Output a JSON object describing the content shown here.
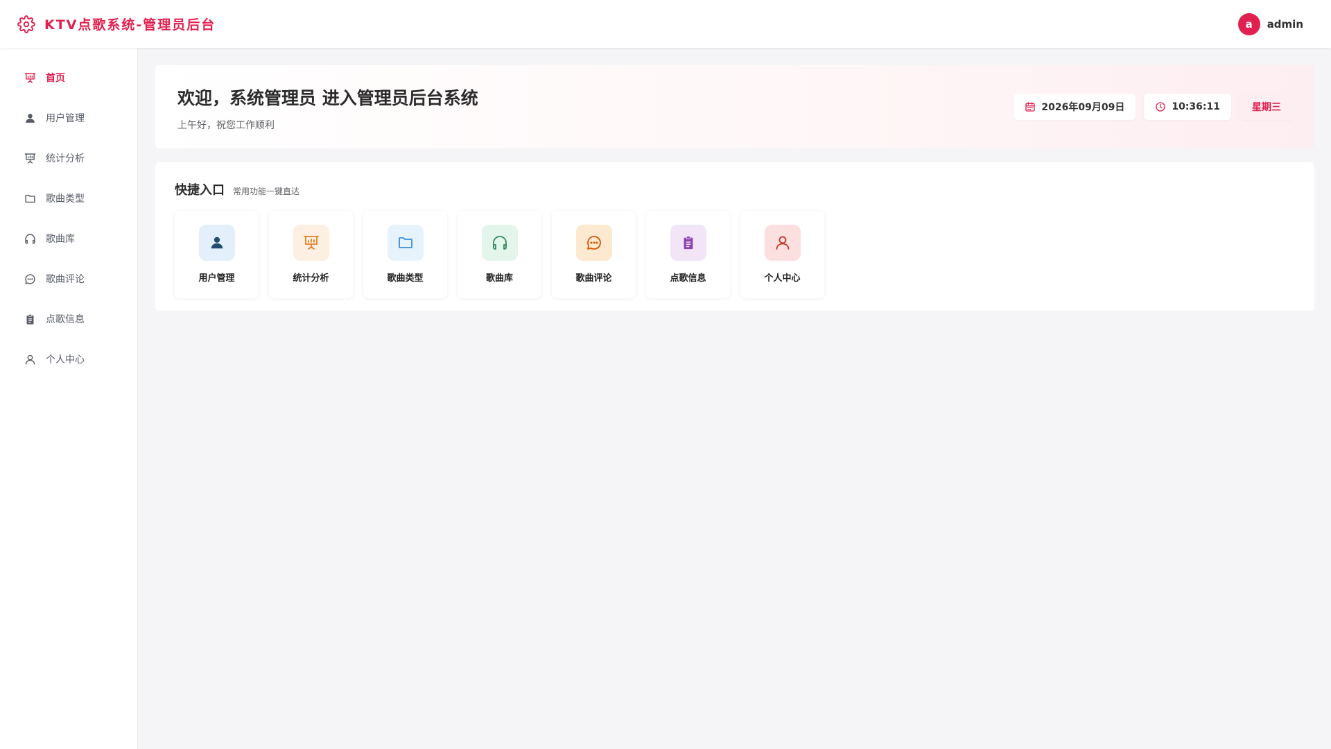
{
  "app": {
    "title": "KTV点歌系统-管理员后台"
  },
  "user": {
    "avatar_letter": "a",
    "name": "admin"
  },
  "colors": {
    "accent": "#e0204f"
  },
  "sidebar": {
    "items": [
      {
        "label": "首页",
        "icon": "presentation-icon",
        "active": true
      },
      {
        "label": "用户管理",
        "icon": "user-icon"
      },
      {
        "label": "统计分析",
        "icon": "presentation-icon"
      },
      {
        "label": "歌曲类型",
        "icon": "folder-icon"
      },
      {
        "label": "歌曲库",
        "icon": "headphones-icon"
      },
      {
        "label": "歌曲评论",
        "icon": "comment-icon"
      },
      {
        "label": "点歌信息",
        "icon": "clipboard-icon"
      },
      {
        "label": "个人中心",
        "icon": "user-outline-icon"
      }
    ]
  },
  "welcome": {
    "title": "欢迎，系统管理员 进入管理员后台系统",
    "subtitle": "上午好，祝您工作顺利",
    "date": "2026年09月09日",
    "time": "10:36:11",
    "weekday": "星期三"
  },
  "quick": {
    "title": "快捷入口",
    "subtitle": "常用功能一键直达",
    "cards": [
      {
        "label": "用户管理",
        "icon": "user-icon",
        "color": "#1f4e6e",
        "bg": "#e3f0fb"
      },
      {
        "label": "统计分析",
        "icon": "presentation-icon",
        "color": "#e67e22",
        "bg": "#fdf0e2"
      },
      {
        "label": "歌曲类型",
        "icon": "folder-icon",
        "color": "#3a8fd6",
        "bg": "#e6f2fc"
      },
      {
        "label": "歌曲库",
        "icon": "headphones-icon",
        "color": "#2e8b57",
        "bg": "#e4f5ec"
      },
      {
        "label": "歌曲评论",
        "icon": "comment-icon",
        "color": "#d35400",
        "bg": "#fde9cf"
      },
      {
        "label": "点歌信息",
        "icon": "clipboard-icon",
        "color": "#8e44ad",
        "bg": "#f1e5f7"
      },
      {
        "label": "个人中心",
        "icon": "user-outline-icon",
        "color": "#c0392b",
        "bg": "#fbe0df"
      }
    ]
  }
}
